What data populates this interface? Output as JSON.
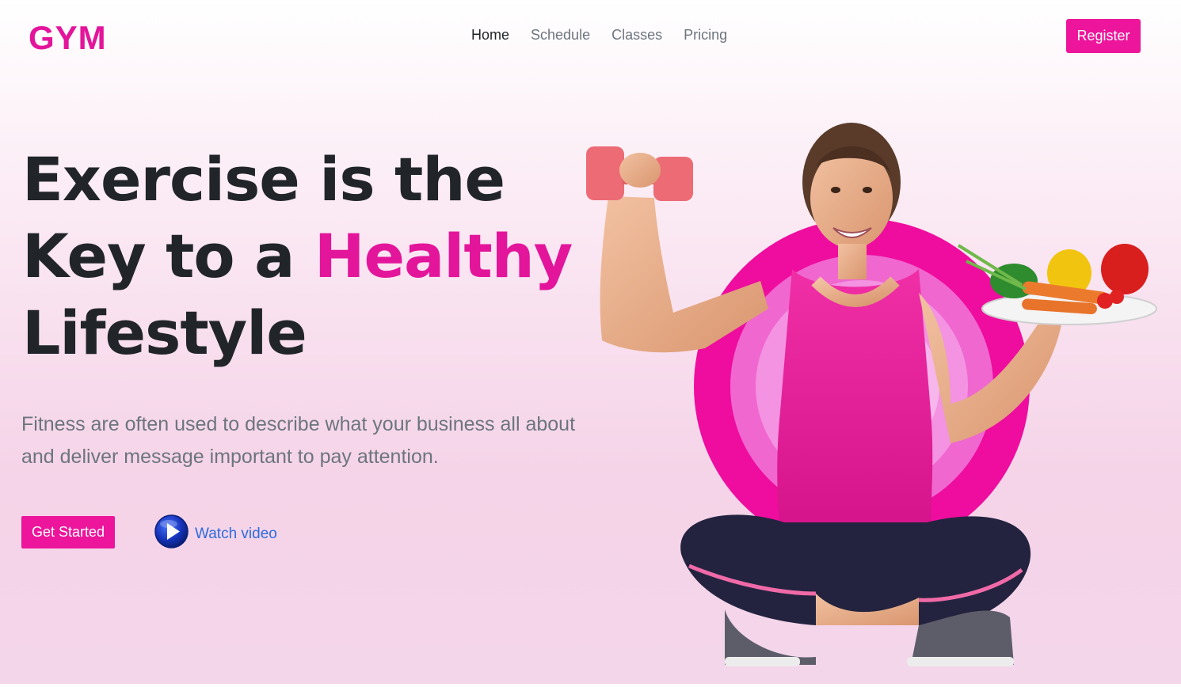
{
  "brand": {
    "logo": "GYM"
  },
  "nav": {
    "items": [
      {
        "label": "Home",
        "active": true
      },
      {
        "label": "Schedule"
      },
      {
        "label": "Classes"
      },
      {
        "label": "Pricing"
      }
    ],
    "register_label": "Register"
  },
  "hero": {
    "headline_part1": "Exercise is the Key to a ",
    "headline_accent": "Healthy",
    "headline_part2": " Lifestyle",
    "subtitle": "Fitness are often used to describe what your business all about and deliver message important to pay attention.",
    "cta_label": "Get Started",
    "video_label": "Watch video"
  },
  "colors": {
    "accent": "#e3159b",
    "link": "#2d6be0",
    "text": "#212529",
    "muted": "#6c757d"
  },
  "icons": {
    "play": "play-icon"
  }
}
